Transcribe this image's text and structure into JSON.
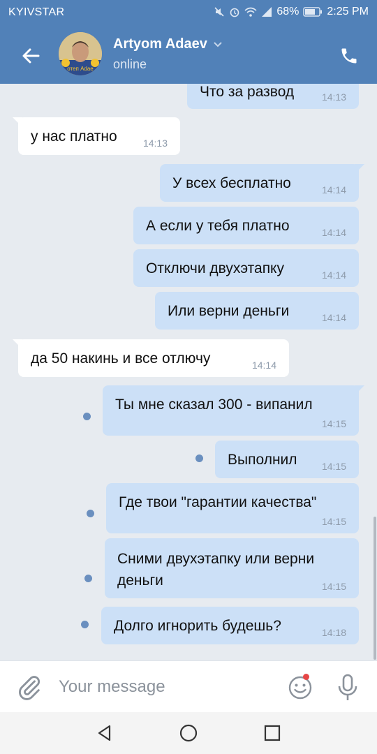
{
  "status_bar": {
    "carrier": "KYIVSTAR",
    "battery": "68%",
    "time": "2:25 PM"
  },
  "header": {
    "contact_name": "Artyom Adaev",
    "contact_status": "online",
    "avatar_caption": "отеп Adae"
  },
  "messages": [
    {
      "dir": "out",
      "text": "Что за развод",
      "time": "14:13"
    },
    {
      "dir": "in",
      "text": "у нас платно",
      "time": "14:13"
    },
    {
      "dir": "out",
      "text": "У всех бесплатно",
      "time": "14:14"
    },
    {
      "dir": "out",
      "text": "А если у тебя платно",
      "time": "14:14"
    },
    {
      "dir": "out",
      "text": "Отключи двухэтапку",
      "time": "14:14"
    },
    {
      "dir": "out",
      "text": "Или верни деньги",
      "time": "14:14"
    },
    {
      "dir": "in",
      "text": "да 50 накинь и все отлючу",
      "time": "14:14"
    },
    {
      "dir": "out",
      "text": "Ты мне сказал 300 - випанил",
      "time": "14:15",
      "unread": true
    },
    {
      "dir": "out",
      "text": "Выполнил",
      "time": "14:15",
      "unread": true
    },
    {
      "dir": "out",
      "text": "Где твои \"гарантии качества\"",
      "time": "14:15",
      "unread": true
    },
    {
      "dir": "out",
      "text": "Сними двухэтапку или верни деньги",
      "time": "14:15",
      "unread": true
    },
    {
      "dir": "out",
      "text": "Долго игнорить будешь?",
      "time": "14:18",
      "unread": true
    }
  ],
  "composer": {
    "placeholder": "Your message"
  },
  "colors": {
    "header_bg": "#5181b8",
    "outgoing_bubble": "#cce0f7",
    "incoming_bubble": "#ffffff",
    "chat_bg": "#e7ebf0",
    "unread_dot": "#6a8fbf",
    "notification_dot": "#e64646"
  },
  "icons": [
    "back-arrow-icon",
    "phone-icon",
    "chevron-down-icon",
    "paperclip-icon",
    "smiley-icon",
    "microphone-icon",
    "nav-back-icon",
    "nav-home-icon",
    "nav-recents-icon"
  ]
}
